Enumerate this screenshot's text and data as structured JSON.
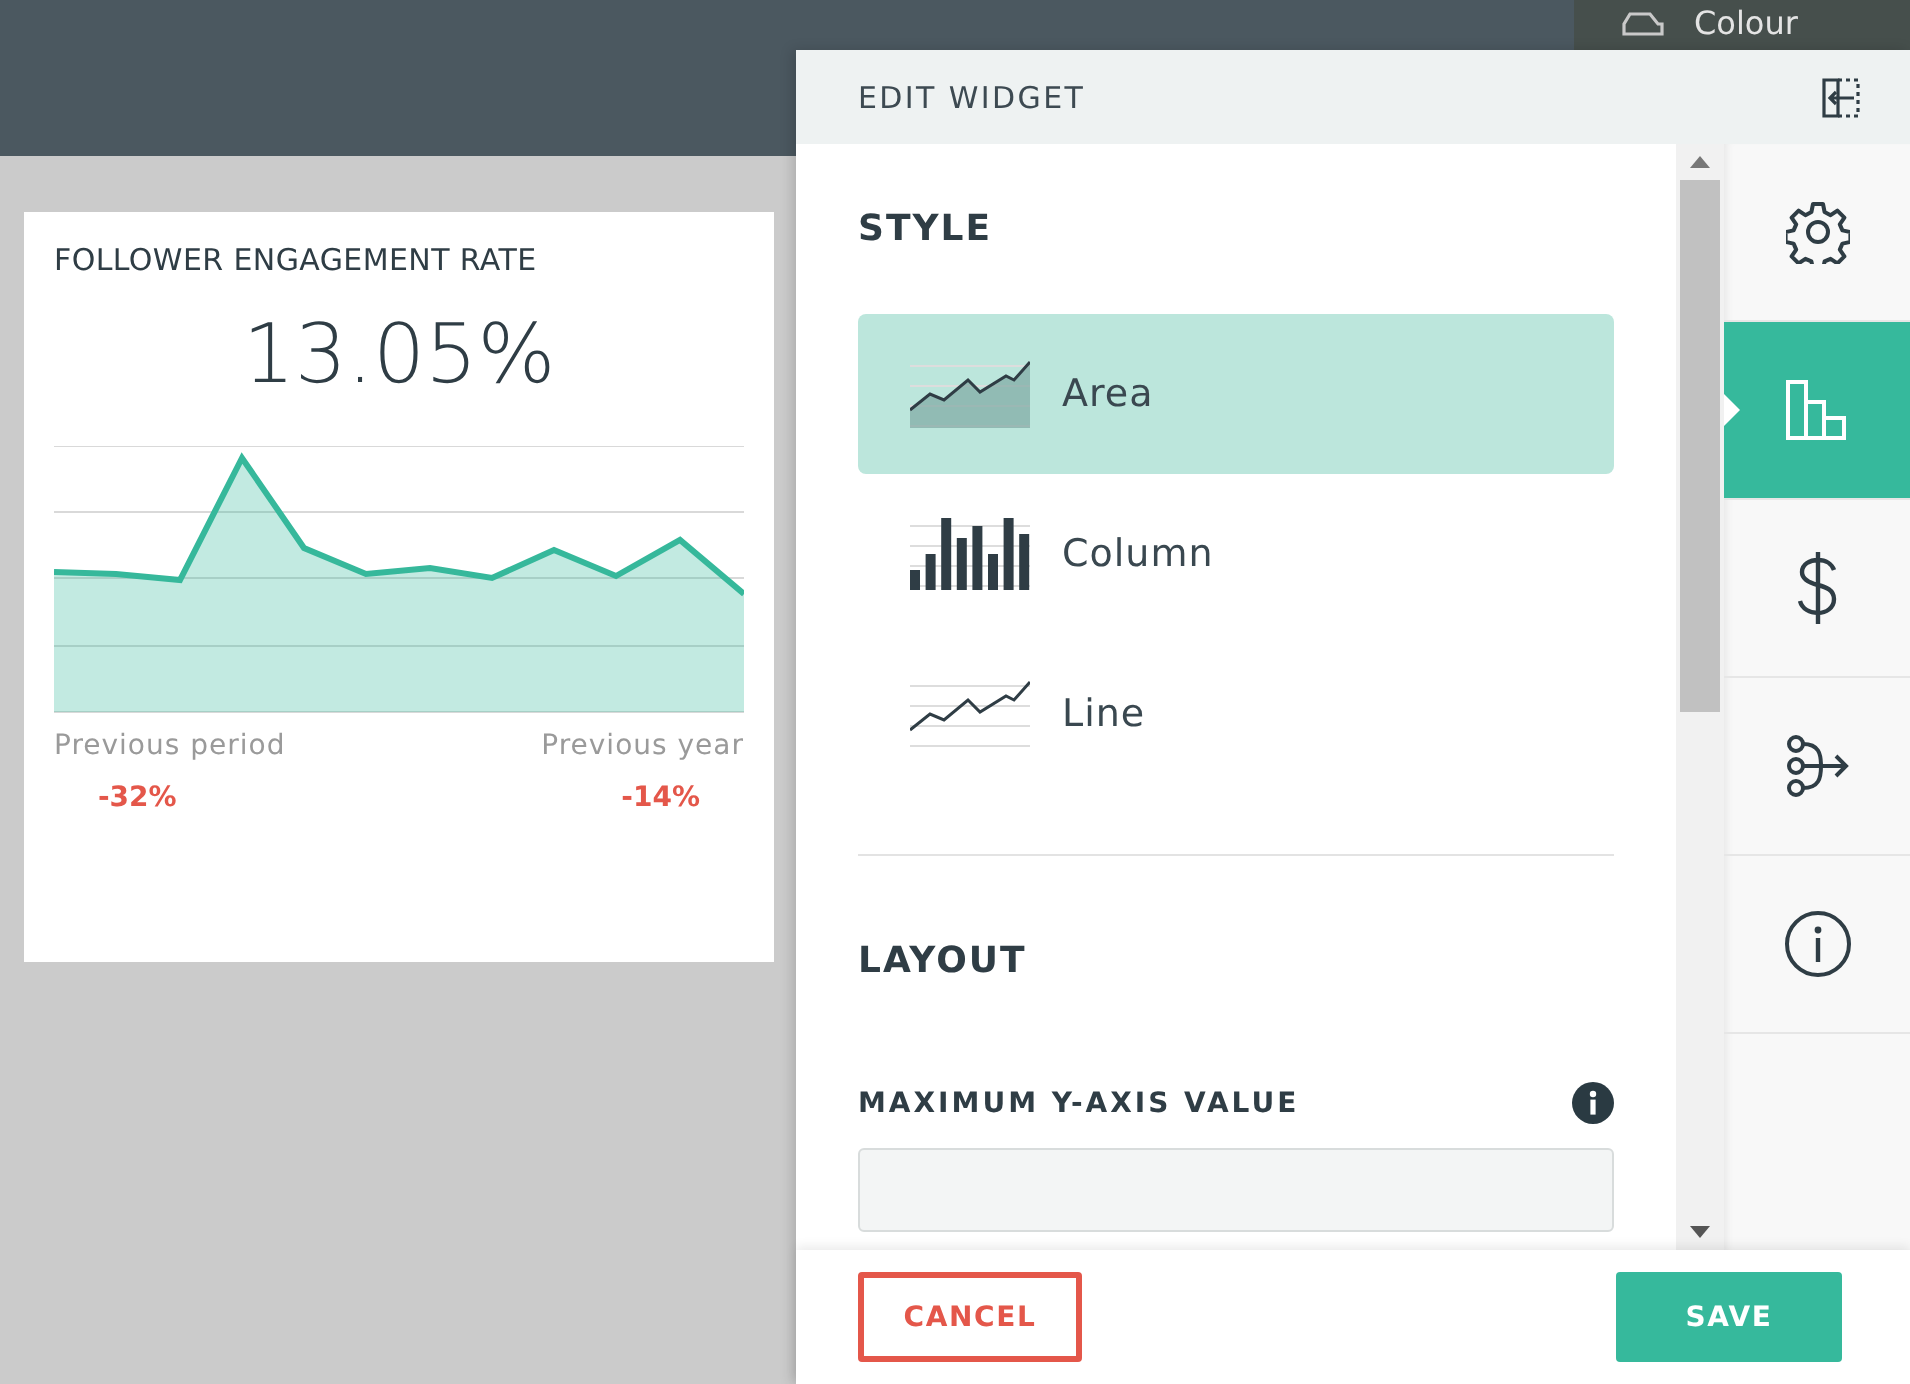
{
  "top_bar": {
    "label": "Colour"
  },
  "widget": {
    "title": "FOLLOWER ENGAGEMENT RATE",
    "value": "13.05%",
    "comparisons": [
      {
        "label": "Previous period",
        "change": "-32%"
      },
      {
        "label": "Previous year",
        "change": "-14%"
      }
    ]
  },
  "edit_panel": {
    "title": "EDIT WIDGET",
    "sections": [
      {
        "title": "STYLE"
      },
      {
        "title": "LAYOUT"
      }
    ],
    "style_options": [
      {
        "kind": "area",
        "label": "Area",
        "selected": true
      },
      {
        "kind": "column",
        "label": "Column",
        "selected": false
      },
      {
        "kind": "line",
        "label": "Line",
        "selected": false
      }
    ],
    "max_y_field": {
      "label": "MAXIMUM Y-AXIS VALUE"
    },
    "tabs": [
      {
        "kind": "settings",
        "selected": false
      },
      {
        "kind": "chart",
        "selected": true
      },
      {
        "kind": "currency",
        "selected": false
      },
      {
        "kind": "flow",
        "selected": false
      },
      {
        "kind": "info",
        "selected": false
      }
    ],
    "buttons": [
      {
        "kind": "cancel",
        "label": "CANCEL"
      },
      {
        "kind": "save",
        "label": "SAVE"
      }
    ]
  }
}
